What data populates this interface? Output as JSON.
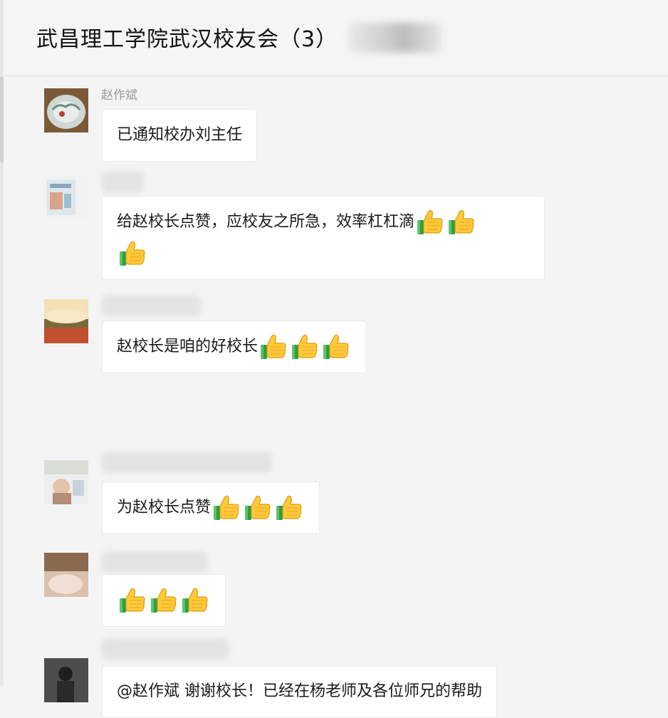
{
  "header": {
    "title": "武昌理工学院武汉校友会（3）"
  },
  "messages": [
    {
      "sender": "赵作斌",
      "text": "已通知校办刘主任",
      "thumbs": 0
    },
    {
      "sender": "",
      "text": "给赵校长点赞，应校友之所急，效率杠杠滴",
      "thumbs": 3
    },
    {
      "sender": "",
      "text": "赵校长是咱的好校长",
      "thumbs": 3
    },
    {
      "sender": "",
      "text": "为赵校长点赞",
      "thumbs": 3
    },
    {
      "sender": "",
      "text": "",
      "thumbs": 3
    },
    {
      "sender": "",
      "text": "@赵作斌 谢谢校长！已经在杨老师及各位师兄的帮助",
      "thumbs": 0
    }
  ],
  "icons": {
    "thumbs_up": "thumbs-up-emoji-icon"
  },
  "colors": {
    "background": "#f4f4f4",
    "bubble": "#ffffff",
    "name": "#9a9a9a"
  }
}
